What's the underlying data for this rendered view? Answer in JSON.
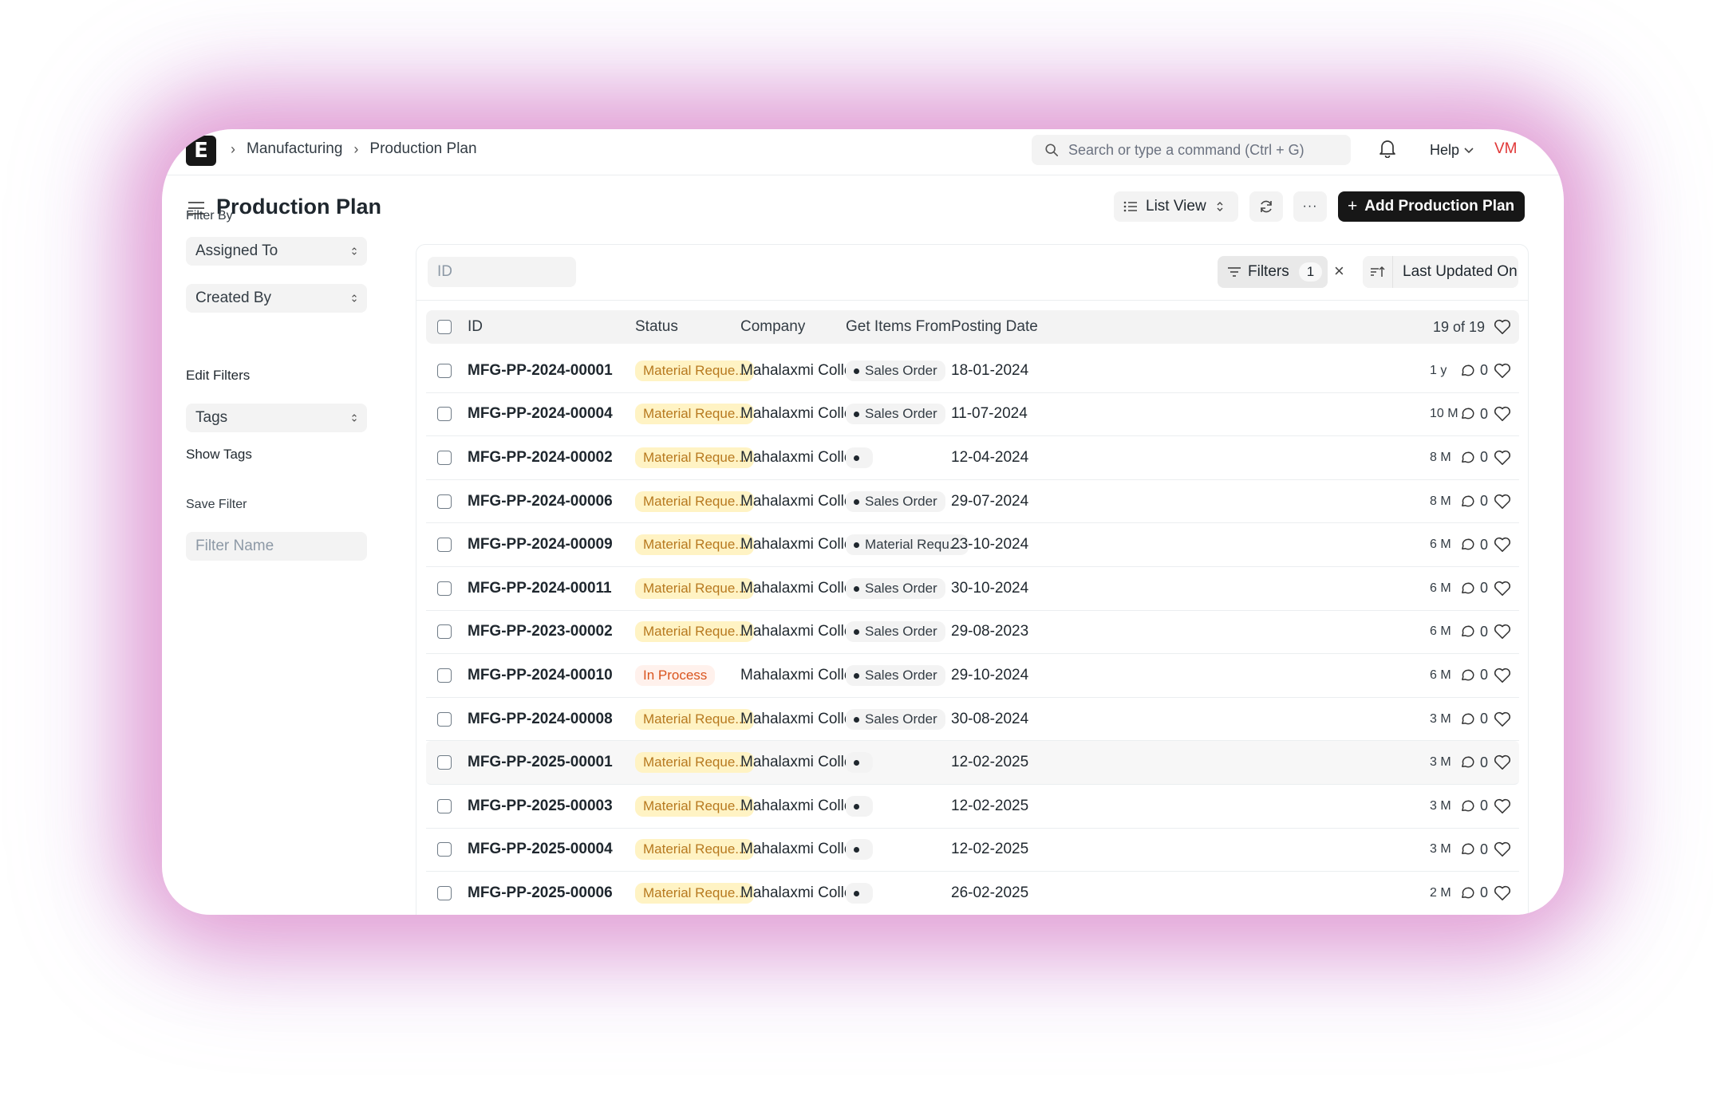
{
  "nav": {
    "logo": "E",
    "breadcrumbs": [
      "Manufacturing",
      "Production Plan"
    ],
    "search_placeholder": "Search or type a command (Ctrl + G)",
    "help": "Help",
    "avatar": "VM"
  },
  "header": {
    "title": "Production Plan",
    "list_view": "List View",
    "more": "···",
    "add": "Add Production Plan"
  },
  "sidebar": {
    "filter_by": "Filter By",
    "assigned_to": "Assigned To",
    "created_by": "Created By",
    "edit_filters": "Edit Filters",
    "tags": "Tags",
    "show_tags": "Show Tags",
    "save_filter": "Save Filter",
    "filter_name_placeholder": "Filter Name"
  },
  "list": {
    "id_placeholder": "ID",
    "filters_label": "Filters",
    "filters_count": "1",
    "sort_label": "Last Updated On",
    "columns": {
      "id": "ID",
      "status": "Status",
      "company": "Company",
      "source": "Get Items From",
      "date": "Posting Date",
      "count": "19 of 19"
    },
    "rows": [
      {
        "id": "MFG-PP-2024-00001",
        "status": "Material Reque...",
        "company": "Mahalaxmi Colle···",
        "source": "Sales Order",
        "date": "18-01-2024",
        "age": "1 y",
        "comments": "0"
      },
      {
        "id": "MFG-PP-2024-00004",
        "status": "Material Reque...",
        "company": "Mahalaxmi Colle···",
        "source": "Sales Order",
        "date": "11-07-2024",
        "age": "10 M",
        "comments": "0"
      },
      {
        "id": "MFG-PP-2024-00002",
        "status": "Material Reque...",
        "company": "Mahalaxmi Colle···",
        "source": "",
        "date": "12-04-2024",
        "age": "8 M",
        "comments": "0"
      },
      {
        "id": "MFG-PP-2024-00006",
        "status": "Material Reque...",
        "company": "Mahalaxmi Colle···",
        "source": "Sales Order",
        "date": "29-07-2024",
        "age": "8 M",
        "comments": "0"
      },
      {
        "id": "MFG-PP-2024-00009",
        "status": "Material Reque...",
        "company": "Mahalaxmi Colle···",
        "source": "Material Requ...",
        "date": "23-10-2024",
        "age": "6 M",
        "comments": "0"
      },
      {
        "id": "MFG-PP-2024-00011",
        "status": "Material Reque...",
        "company": "Mahalaxmi Colle···",
        "source": "Sales Order",
        "date": "30-10-2024",
        "age": "6 M",
        "comments": "0"
      },
      {
        "id": "MFG-PP-2023-00002",
        "status": "Material Reque...",
        "company": "Mahalaxmi Colle···",
        "source": "Sales Order",
        "date": "29-08-2023",
        "age": "6 M",
        "comments": "0"
      },
      {
        "id": "MFG-PP-2024-00010",
        "status": "In Process",
        "company": "Mahalaxmi Colle···",
        "source": "Sales Order",
        "date": "29-10-2024",
        "age": "6 M",
        "comments": "0"
      },
      {
        "id": "MFG-PP-2024-00008",
        "status": "Material Reque...",
        "company": "Mahalaxmi Colle···",
        "source": "Sales Order",
        "date": "30-08-2024",
        "age": "3 M",
        "comments": "0"
      },
      {
        "id": "MFG-PP-2025-00001",
        "status": "Material Reque...",
        "company": "Mahalaxmi Colle···",
        "source": "",
        "date": "12-02-2025",
        "age": "3 M",
        "comments": "0"
      },
      {
        "id": "MFG-PP-2025-00003",
        "status": "Material Reque...",
        "company": "Mahalaxmi Colle···",
        "source": "",
        "date": "12-02-2025",
        "age": "3 M",
        "comments": "0"
      },
      {
        "id": "MFG-PP-2025-00004",
        "status": "Material Reque...",
        "company": "Mahalaxmi Colle···",
        "source": "",
        "date": "12-02-2025",
        "age": "3 M",
        "comments": "0"
      },
      {
        "id": "MFG-PP-2025-00006",
        "status": "Material Reque...",
        "company": "Mahalaxmi Colle···",
        "source": "",
        "date": "26-02-2025",
        "age": "2 M",
        "comments": "0"
      }
    ]
  },
  "colors": {
    "status_yellow_bg": "#fff3c4",
    "status_yellow_text": "#b7791f",
    "status_orange_text": "#d9541e",
    "primary_button": "#171717",
    "avatar_text": "#e03636"
  }
}
